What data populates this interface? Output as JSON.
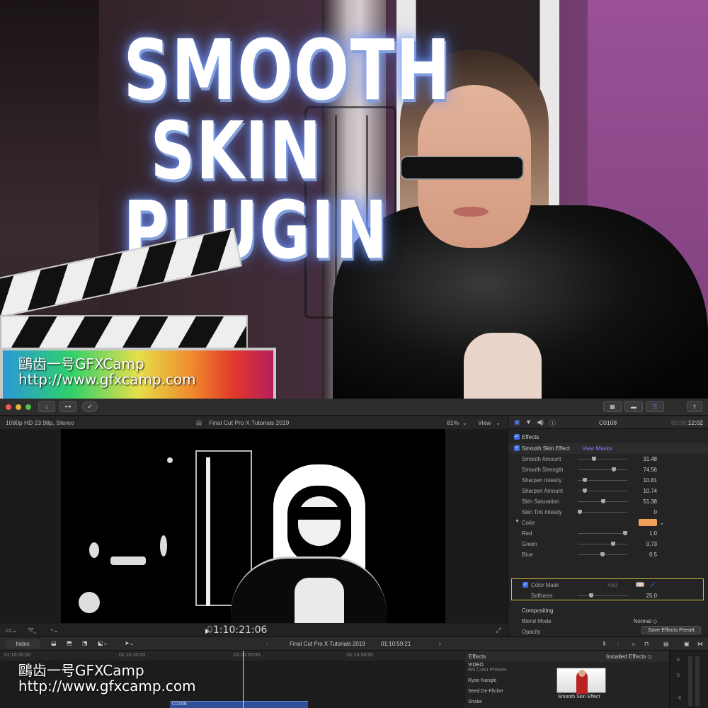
{
  "hero": {
    "title_lines": [
      "SMOOTH",
      "SKIN",
      "PLUGIN"
    ],
    "watermark_name": "鷗齿一号GFXCamp",
    "watermark_url": "http://www.gfxcamp.com"
  },
  "toolbar": {
    "import_icon": "↓",
    "key_icon": "⊶",
    "check_icon": "✓",
    "share_icon": "⇪"
  },
  "viewer": {
    "format": "1080p HD 23.98p, Stereo",
    "library": "Final Cut Pro X Tutorials 2019",
    "zoom": "81%",
    "view_menu": "View",
    "timecode": "1:10:21:06"
  },
  "inspector": {
    "clip_name": "C0108",
    "duration_prefix": "00:00:",
    "duration_value": "12:02",
    "effects_label": "Effects",
    "effect_name": "Smooth Skin Effect",
    "view_masks": "View Masks",
    "params": [
      {
        "label": "Smooth Amount",
        "value": "31.48",
        "level": 0.31
      },
      {
        "label": "Smooth Strength",
        "value": "74.56",
        "level": 0.75
      },
      {
        "label": "Sharpen Intesity",
        "value": "10.81",
        "level": 0.11
      },
      {
        "label": "Sharpen Amount",
        "value": "10.74",
        "level": 0.11
      },
      {
        "label": "Skin Saturation",
        "value": "51.38",
        "level": 0.51
      },
      {
        "label": "Skin Tint Intesity",
        "value": "0",
        "level": 0.0
      }
    ],
    "color_label": "Color",
    "color_swatch": "#f2a05a",
    "rgb": [
      {
        "label": "Red",
        "value": "1.0",
        "level": 1.0
      },
      {
        "label": "Green",
        "value": "0.73",
        "level": 0.73
      },
      {
        "label": "Blue",
        "value": "0.5",
        "level": 0.5
      }
    ],
    "color_mask_label": "Color Mask",
    "color_mask_add": "Add",
    "softness_label": "Softness",
    "softness_value": "25.0",
    "softness_level": 0.25,
    "compositing_label": "Compositing",
    "blend_mode_label": "Blend Mode",
    "blend_mode_value": "Normal ◇",
    "opacity_label": "Opacity",
    "opacity_value": "100.0 %",
    "save_preset": "Save Effects Preset"
  },
  "timeline": {
    "index": "Index",
    "project": "Final Cut Pro X Tutorials 2019",
    "project_time": "01:10:59:21",
    "ruler": [
      "01:10:00:00",
      "01:10:10:00",
      "01:10:20:00",
      "01:10:30:00"
    ],
    "clip_name": "C0108"
  },
  "effects_browser": {
    "title": "Effects",
    "installed": "Installed Effects ◇",
    "category": "VIDEO",
    "items": [
      "RN Color Presets",
      "Ryan Nangle",
      "Seed De-Flicker",
      "Shake"
    ],
    "thumb_label": "Smooth Skin Effect"
  },
  "meters": {
    "labels": [
      "6",
      "0",
      "-6"
    ]
  },
  "colors": {
    "accent": "#3f6fe8",
    "mask_outline": "#d4c23a",
    "clip": "#2f4f9a"
  }
}
